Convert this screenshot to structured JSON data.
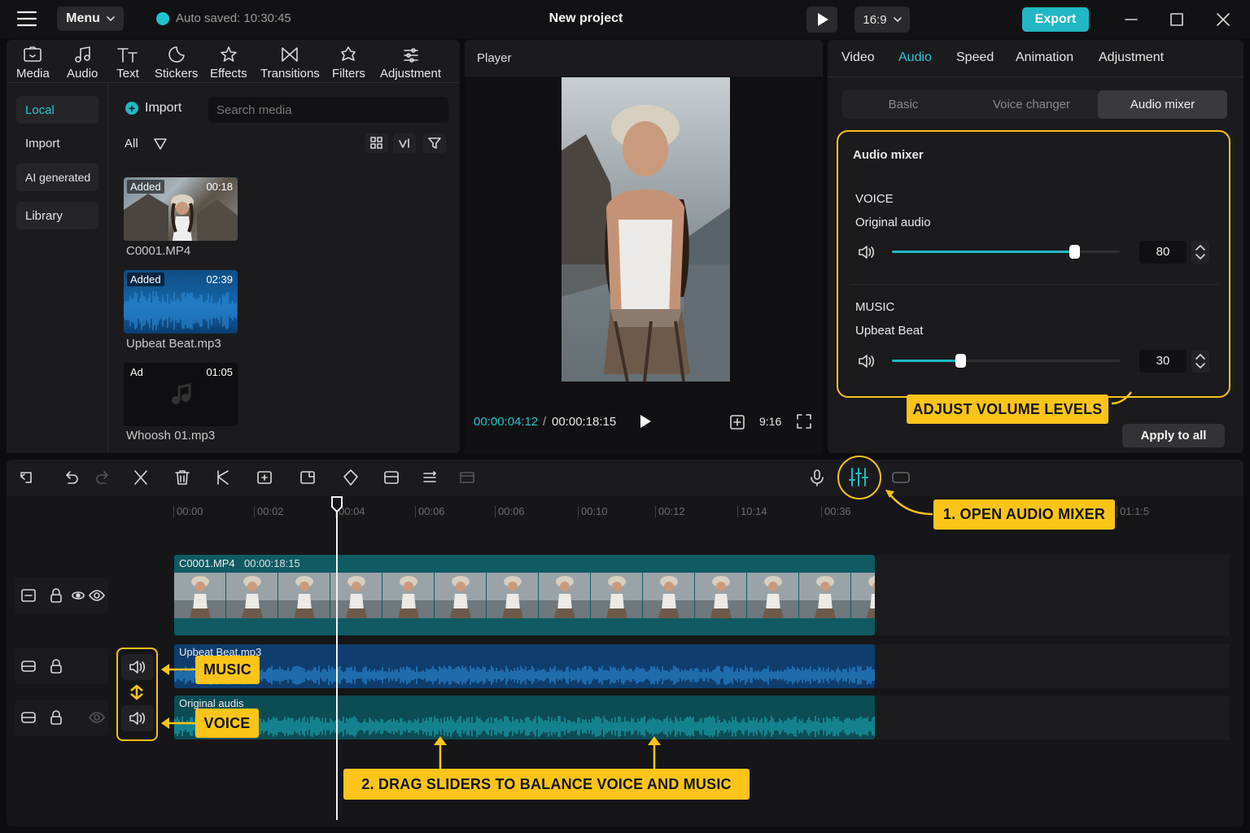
{
  "topbar": {
    "menu_label": "Menu",
    "autosave": "Auto saved: 10:30:45",
    "project_title": "New project",
    "aspect_ratio": "16:9",
    "export_label": "Export"
  },
  "toolbar": {
    "tools": [
      {
        "label": "Media",
        "icon": "media-icon"
      },
      {
        "label": "Audio",
        "icon": "audio-icon"
      },
      {
        "label": "Text",
        "icon": "text-icon"
      },
      {
        "label": "Stickers",
        "icon": "stickers-icon"
      },
      {
        "label": "Effects",
        "icon": "effects-icon"
      },
      {
        "label": "Transitions",
        "icon": "transitions-icon"
      },
      {
        "label": "Filters",
        "icon": "filters-icon"
      },
      {
        "label": "Adjustment",
        "icon": "adjustment-icon"
      }
    ]
  },
  "media": {
    "nav": [
      "Local",
      "Import",
      "AI generated",
      "Library"
    ],
    "import_label": "Import",
    "search_placeholder": "Search media",
    "filter_all": "All",
    "items": [
      {
        "badge": "Added",
        "duration": "00:18",
        "name": "C0001.MP4"
      },
      {
        "badge": "Added",
        "duration": "02:39",
        "name": "Upbeat Beat.mp3"
      },
      {
        "badge": "Ad",
        "duration": "01:05",
        "name": "Whoosh 01.mp3"
      }
    ]
  },
  "player": {
    "title": "Player",
    "current_time": "00:00:04:12",
    "separator": "/",
    "total_time": "00:00:18:15",
    "ratio": "9:16"
  },
  "inspector": {
    "tabs": [
      "Video",
      "Audio",
      "Speed",
      "Animation",
      "Adjustment"
    ],
    "active_tab": "Audio",
    "segments": [
      "Basic",
      "Voice changer",
      "Audio mixer"
    ],
    "active_segment": "Audio mixer",
    "mixer_title": "Audio mixer",
    "voice": {
      "heading": "VOICE",
      "source": "Original audio",
      "value": "80",
      "level": 0.8
    },
    "music": {
      "heading": "MUSIC",
      "source": "Upbeat Beat",
      "value": "30",
      "level": 0.3
    },
    "apply_all": "Apply to all"
  },
  "callouts": {
    "adjust": "ADJUST VOLUME LEVELS",
    "open_mixer": "1. OPEN AUDIO MIXER",
    "music": "MUSIC",
    "voice": "VOICE",
    "drag": "2. DRAG SLIDERS TO BALANCE VOICE AND MUSIC"
  },
  "timeline": {
    "ruler": [
      "00:00",
      "00:02",
      "00:04",
      "00:06",
      "00:06",
      "00:10",
      "00:12",
      "10:14",
      "00:36",
      "01:1:5"
    ],
    "video_clip": {
      "name": "C0001.MP4",
      "duration": "00:00:18:15"
    },
    "music_clip": "Upbeat Beat.mp3",
    "voice_clip": "Original audis"
  },
  "colors": {
    "accent": "#21b7c4",
    "callout": "#fcc419",
    "panel": "#1b1b1e",
    "music_wave": "#1b6fb0",
    "voice_wave": "#138a94"
  }
}
